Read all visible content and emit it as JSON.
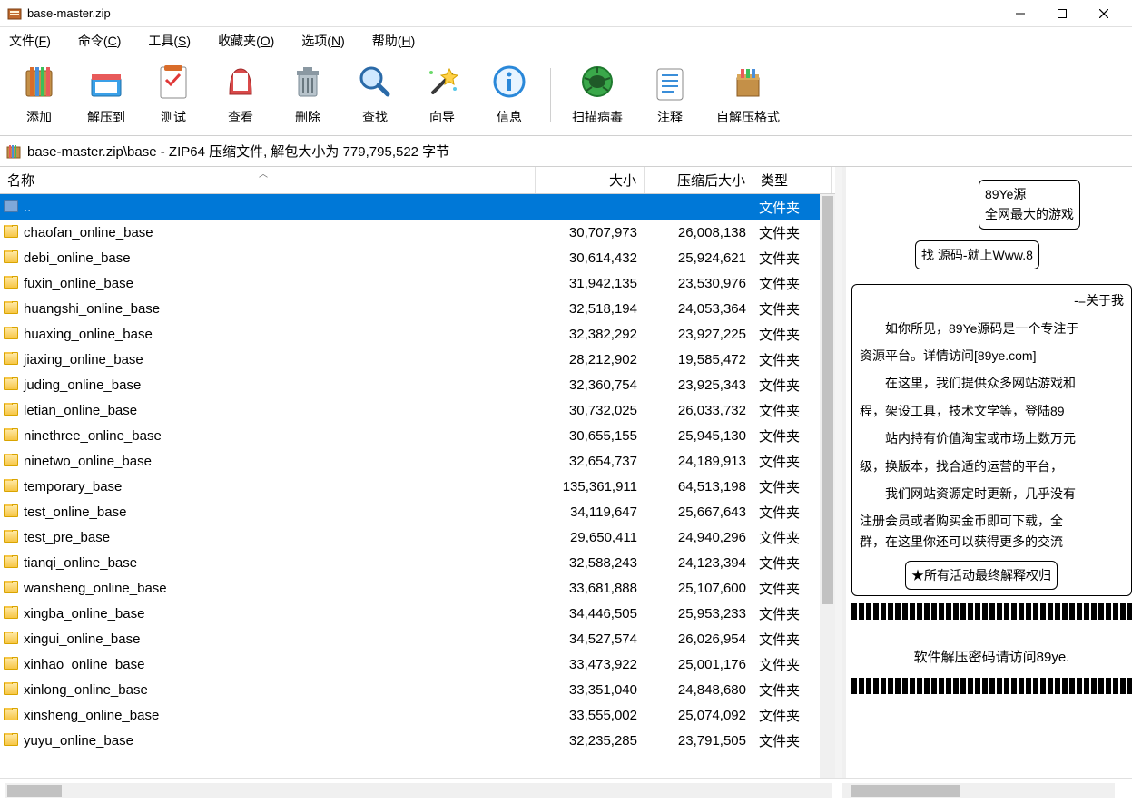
{
  "window": {
    "title": "base-master.zip"
  },
  "menus": [
    {
      "label": "文件",
      "key": "F"
    },
    {
      "label": "命令",
      "key": "C"
    },
    {
      "label": "工具",
      "key": "S"
    },
    {
      "label": "收藏夹",
      "key": "O"
    },
    {
      "label": "选项",
      "key": "N"
    },
    {
      "label": "帮助",
      "key": "H"
    }
  ],
  "toolbar": [
    {
      "id": "add",
      "label": "添加"
    },
    {
      "id": "extract",
      "label": "解压到"
    },
    {
      "id": "test",
      "label": "测试"
    },
    {
      "id": "view",
      "label": "查看"
    },
    {
      "id": "delete",
      "label": "删除"
    },
    {
      "id": "find",
      "label": "查找"
    },
    {
      "id": "wizard",
      "label": "向导"
    },
    {
      "id": "info",
      "label": "信息"
    },
    {
      "id": "sep",
      "label": ""
    },
    {
      "id": "virus",
      "label": "扫描病毒"
    },
    {
      "id": "comment",
      "label": "注释"
    },
    {
      "id": "sfx",
      "label": "自解压格式"
    }
  ],
  "path": "base-master.zip\\base - ZIP64 压缩文件, 解包大小为 779,795,522 字节",
  "columns": {
    "name": "名称",
    "size": "大小",
    "packed": "压缩后大小",
    "type": "类型"
  },
  "type_folder": "文件夹",
  "rows": [
    {
      "name": "..",
      "size": "",
      "packed": "",
      "type": "文件夹",
      "up": true,
      "selected": true
    },
    {
      "name": "chaofan_online_base",
      "size": "30,707,973",
      "packed": "26,008,138",
      "type": "文件夹"
    },
    {
      "name": "debi_online_base",
      "size": "30,614,432",
      "packed": "25,924,621",
      "type": "文件夹"
    },
    {
      "name": "fuxin_online_base",
      "size": "31,942,135",
      "packed": "23,530,976",
      "type": "文件夹"
    },
    {
      "name": "huangshi_online_base",
      "size": "32,518,194",
      "packed": "24,053,364",
      "type": "文件夹"
    },
    {
      "name": "huaxing_online_base",
      "size": "32,382,292",
      "packed": "23,927,225",
      "type": "文件夹"
    },
    {
      "name": "jiaxing_online_base",
      "size": "28,212,902",
      "packed": "19,585,472",
      "type": "文件夹"
    },
    {
      "name": "juding_online_base",
      "size": "32,360,754",
      "packed": "23,925,343",
      "type": "文件夹"
    },
    {
      "name": "letian_online_base",
      "size": "30,732,025",
      "packed": "26,033,732",
      "type": "文件夹"
    },
    {
      "name": "ninethree_online_base",
      "size": "30,655,155",
      "packed": "25,945,130",
      "type": "文件夹"
    },
    {
      "name": "ninetwo_online_base",
      "size": "32,654,737",
      "packed": "24,189,913",
      "type": "文件夹"
    },
    {
      "name": "temporary_base",
      "size": "135,361,911",
      "packed": "64,513,198",
      "type": "文件夹"
    },
    {
      "name": "test_online_base",
      "size": "34,119,647",
      "packed": "25,667,643",
      "type": "文件夹"
    },
    {
      "name": "test_pre_base",
      "size": "29,650,411",
      "packed": "24,940,296",
      "type": "文件夹"
    },
    {
      "name": "tianqi_online_base",
      "size": "32,588,243",
      "packed": "24,123,394",
      "type": "文件夹"
    },
    {
      "name": "wansheng_online_base",
      "size": "33,681,888",
      "packed": "25,107,600",
      "type": "文件夹"
    },
    {
      "name": "xingba_online_base",
      "size": "34,446,505",
      "packed": "25,953,233",
      "type": "文件夹"
    },
    {
      "name": "xingui_online_base",
      "size": "34,527,574",
      "packed": "26,026,954",
      "type": "文件夹"
    },
    {
      "name": "xinhao_online_base",
      "size": "33,473,922",
      "packed": "25,001,176",
      "type": "文件夹"
    },
    {
      "name": "xinlong_online_base",
      "size": "33,351,040",
      "packed": "24,848,680",
      "type": "文件夹"
    },
    {
      "name": "xinsheng_online_base",
      "size": "33,555,002",
      "packed": "25,074,092",
      "type": "文件夹"
    },
    {
      "name": "yuyu_online_base",
      "size": "32,235,285",
      "packed": "23,791,505",
      "type": "文件夹"
    }
  ],
  "preview": {
    "box1a": "89Ye源",
    "box1b": "全网最大的游戏",
    "box2": "找 源码-就上Www.8",
    "heading": "-=关于我",
    "p1": "如你所见，89Ye源码是一个专注于",
    "p1b": "资源平台。详情访问[89ye.com]",
    "p2": "在这里，我们提供众多网站游戏和",
    "p2b": "程，架设工具，技术文学等，登陆89",
    "p3": "站内持有价值淘宝或市场上数万元",
    "p3b": "级，换版本，找合适的运营的平台，",
    "p4": "我们网站资源定时更新，几乎没有",
    "p4b": "注册会员或者购买金币即可下载，全",
    "p4c": "群，在这里你还可以获得更多的交流",
    "box3": "★所有活动最终解释权归",
    "mid": "软件解压密码请访问89ye."
  }
}
